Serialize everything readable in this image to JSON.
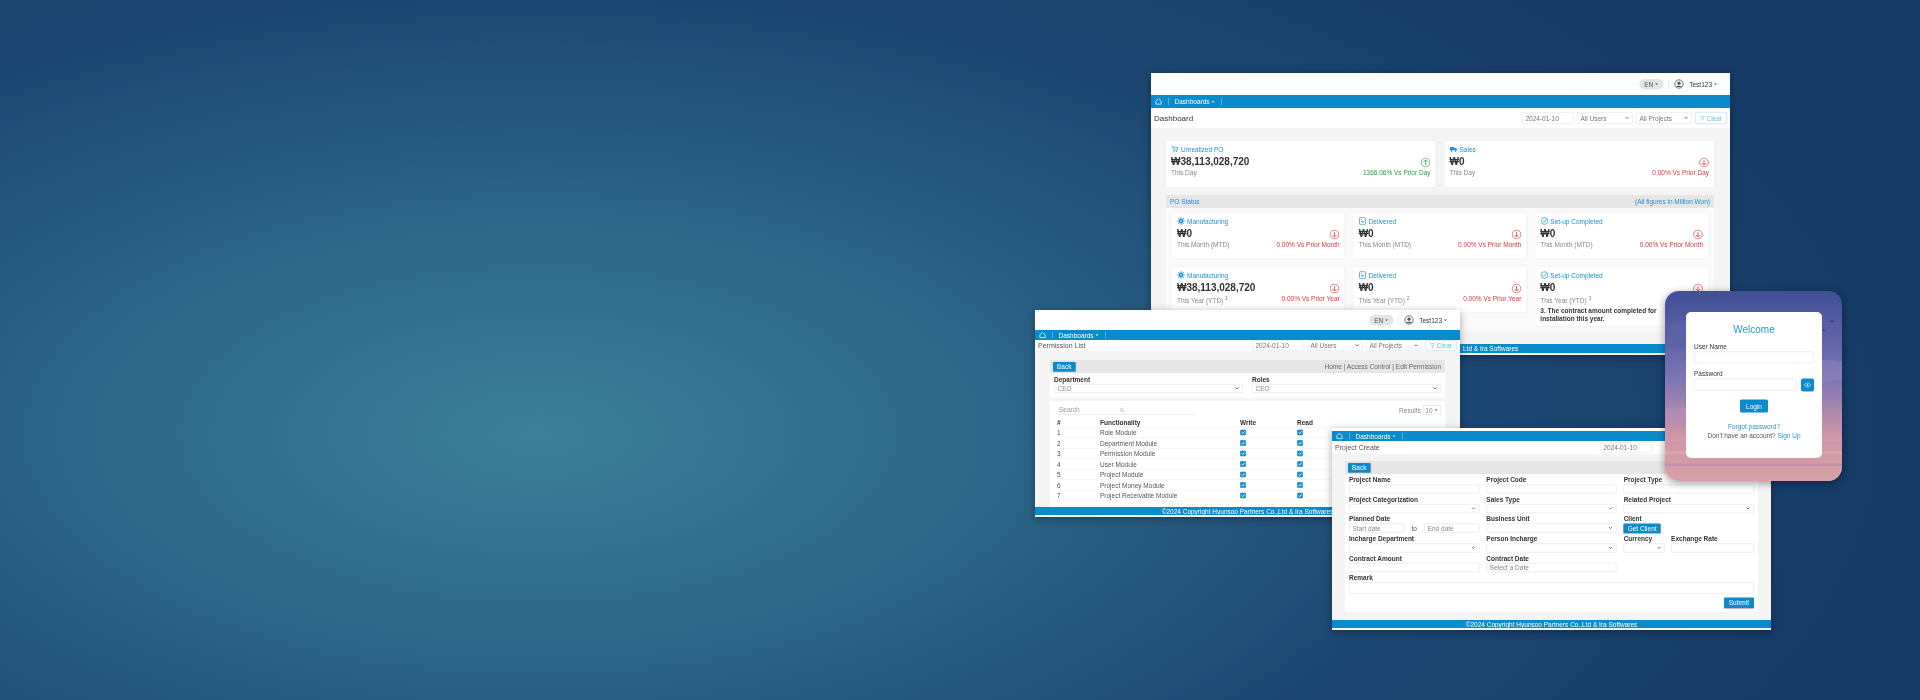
{
  "dashboard_window": {
    "language": "EN",
    "user": "Test123",
    "nav": "Dashboards",
    "title": "Dashboard",
    "filters": {
      "date": "2024-01-10",
      "users": "All Users",
      "projects": "All Projects",
      "clear": "Clear"
    },
    "top_cards": [
      {
        "title": "Unrealized PO",
        "amount": "₩38,113,028,720",
        "period": "This Day",
        "change": "1366.06% Vs Prior Day",
        "up": true
      },
      {
        "title": "Sales",
        "amount": "₩0",
        "period": "This Day",
        "change": "0.00% Vs Prior Day",
        "up": false
      }
    ],
    "section": {
      "title": "PO Status",
      "note": "(All figures in Million Won)"
    },
    "status_cards": [
      {
        "title": "Manufacturing",
        "amount": "₩0",
        "period": "This Month (MTD)",
        "change": "0.00% Vs Prior Month",
        "up": false
      },
      {
        "title": "Delivered",
        "amount": "₩0",
        "period": "This Month (MTD)",
        "change": "0.00% Vs Prior Month",
        "up": false
      },
      {
        "title": "Set-up Completed",
        "amount": "₩0",
        "period": "This Month (MTD)",
        "change": "0.00% Vs Prior Month",
        "up": false
      },
      {
        "title": "Manufacturing",
        "amount": "₩38,113,028,720",
        "period": "This Year (YTD) $^{1}$",
        "change": "0.00% Vs Prior Year",
        "up": false
      },
      {
        "title": "Delivered",
        "amount": "₩0",
        "period": "This Year (YTD) $^{2}$",
        "change": "0.00% Vs Prior Year",
        "up": false
      },
      {
        "title": "Set-up Completed",
        "amount": "₩0",
        "period": "This Year (YTD) $^{3}$",
        "up": false,
        "note": "3. The contract amount completed for installation this year."
      }
    ],
    "footer": "Ltd & Ira Softwares"
  },
  "permission_window": {
    "language": "EN",
    "user": "Test123",
    "nav": "Dashboards",
    "title": "Permission List",
    "filters": {
      "date": "2024-01-10",
      "users": "All Users",
      "projects": "All Projects",
      "clear": "Clear"
    },
    "back": "Back",
    "breadcrumb": "Home | Access Control | Edit Permission",
    "department": {
      "label": "Department",
      "value": "CEO"
    },
    "roles": {
      "label": "Roles",
      "value": "CEO"
    },
    "search": {
      "placeholder": "Search"
    },
    "page_size": {
      "label": "Results",
      "value": "10"
    },
    "columns": [
      "#",
      "Functionality",
      "Write",
      "Read"
    ],
    "rows": [
      {
        "number": "1",
        "functionality": "Role Module",
        "write": true,
        "read": true
      },
      {
        "number": "2",
        "functionality": "Department Module",
        "write": true,
        "read": true
      },
      {
        "number": "3",
        "functionality": "Permission Module",
        "write": true,
        "read": true
      },
      {
        "number": "4",
        "functionality": "User Module",
        "write": true,
        "read": true
      },
      {
        "number": "5",
        "functionality": "Project Module",
        "write": true,
        "read": true
      },
      {
        "number": "6",
        "functionality": "Project Money Module",
        "write": true,
        "read": true
      },
      {
        "number": "7",
        "functionality": "Project Receivable Module",
        "write": true,
        "read": true
      }
    ],
    "footer": "©2024 Copyright Hyunsoo Partners Co.,Ltd & Ira Softwares"
  },
  "project_window": {
    "nav": "Dashboards",
    "title": "Project Create",
    "date": "2024-01-10",
    "back": "Back",
    "fields": [
      {
        "kind": "input",
        "label": "Project Name"
      },
      {
        "kind": "input",
        "label": "Project Code"
      },
      {
        "kind": "input",
        "label": "Project Type"
      },
      {
        "kind": "select",
        "label": "Project Categorization"
      },
      {
        "kind": "select",
        "label": "Sales Type"
      },
      {
        "kind": "select",
        "label": "Related Project"
      },
      {
        "kind": "range",
        "label": "Planned Date",
        "start_placeholder": "Start date",
        "separator": "to",
        "end_placeholder": "End date"
      },
      {
        "kind": "select",
        "label": "Business Unit"
      },
      {
        "kind": "button",
        "label": "Client",
        "button": "Get Client"
      },
      {
        "kind": "select",
        "label": "Incharge Department"
      },
      {
        "kind": "select",
        "label": "Person Incharge"
      },
      {
        "kind": "pair",
        "parts": [
          {
            "kind": "select",
            "label": "Currency"
          },
          {
            "kind": "input",
            "label": "Exchange Rate"
          }
        ]
      },
      {
        "kind": "input",
        "label": "Contract Amount"
      },
      {
        "kind": "input",
        "label": "Contract Date",
        "placeholder": "Select a Date"
      },
      {
        "kind": "textarea",
        "label": "Remark"
      }
    ],
    "submit": "Submit",
    "footer": "©2024 Copyright Hyunsoo Partners Co.,Ltd & Ira Softwares"
  },
  "login_window": {
    "title": "Welcome",
    "username_label": "User Name",
    "password_label": "Password",
    "login": "Login",
    "forgot": "Forgot password?",
    "signup_prompt": "Don't have an account?",
    "signup_link": "Sign Up"
  }
}
